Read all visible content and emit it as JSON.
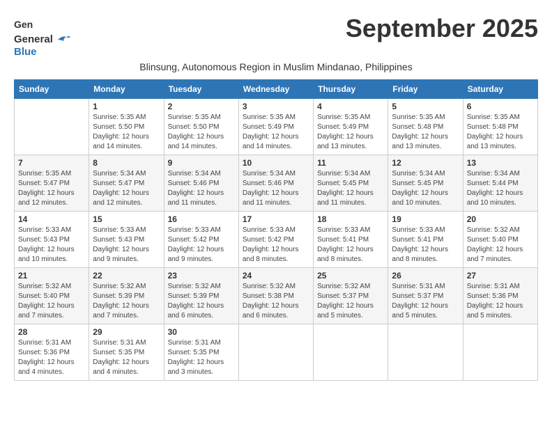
{
  "header": {
    "logo_general": "General",
    "logo_blue": "Blue",
    "month_title": "September 2025",
    "subtitle": "Blinsung, Autonomous Region in Muslim Mindanao, Philippines"
  },
  "days_of_week": [
    "Sunday",
    "Monday",
    "Tuesday",
    "Wednesday",
    "Thursday",
    "Friday",
    "Saturday"
  ],
  "weeks": [
    [
      {
        "day": "",
        "info": ""
      },
      {
        "day": "1",
        "info": "Sunrise: 5:35 AM\nSunset: 5:50 PM\nDaylight: 12 hours\nand 14 minutes."
      },
      {
        "day": "2",
        "info": "Sunrise: 5:35 AM\nSunset: 5:50 PM\nDaylight: 12 hours\nand 14 minutes."
      },
      {
        "day": "3",
        "info": "Sunrise: 5:35 AM\nSunset: 5:49 PM\nDaylight: 12 hours\nand 14 minutes."
      },
      {
        "day": "4",
        "info": "Sunrise: 5:35 AM\nSunset: 5:49 PM\nDaylight: 12 hours\nand 13 minutes."
      },
      {
        "day": "5",
        "info": "Sunrise: 5:35 AM\nSunset: 5:48 PM\nDaylight: 12 hours\nand 13 minutes."
      },
      {
        "day": "6",
        "info": "Sunrise: 5:35 AM\nSunset: 5:48 PM\nDaylight: 12 hours\nand 13 minutes."
      }
    ],
    [
      {
        "day": "7",
        "info": "Sunrise: 5:35 AM\nSunset: 5:47 PM\nDaylight: 12 hours\nand 12 minutes."
      },
      {
        "day": "8",
        "info": "Sunrise: 5:34 AM\nSunset: 5:47 PM\nDaylight: 12 hours\nand 12 minutes."
      },
      {
        "day": "9",
        "info": "Sunrise: 5:34 AM\nSunset: 5:46 PM\nDaylight: 12 hours\nand 11 minutes."
      },
      {
        "day": "10",
        "info": "Sunrise: 5:34 AM\nSunset: 5:46 PM\nDaylight: 12 hours\nand 11 minutes."
      },
      {
        "day": "11",
        "info": "Sunrise: 5:34 AM\nSunset: 5:45 PM\nDaylight: 12 hours\nand 11 minutes."
      },
      {
        "day": "12",
        "info": "Sunrise: 5:34 AM\nSunset: 5:45 PM\nDaylight: 12 hours\nand 10 minutes."
      },
      {
        "day": "13",
        "info": "Sunrise: 5:34 AM\nSunset: 5:44 PM\nDaylight: 12 hours\nand 10 minutes."
      }
    ],
    [
      {
        "day": "14",
        "info": "Sunrise: 5:33 AM\nSunset: 5:43 PM\nDaylight: 12 hours\nand 10 minutes."
      },
      {
        "day": "15",
        "info": "Sunrise: 5:33 AM\nSunset: 5:43 PM\nDaylight: 12 hours\nand 9 minutes."
      },
      {
        "day": "16",
        "info": "Sunrise: 5:33 AM\nSunset: 5:42 PM\nDaylight: 12 hours\nand 9 minutes."
      },
      {
        "day": "17",
        "info": "Sunrise: 5:33 AM\nSunset: 5:42 PM\nDaylight: 12 hours\nand 8 minutes."
      },
      {
        "day": "18",
        "info": "Sunrise: 5:33 AM\nSunset: 5:41 PM\nDaylight: 12 hours\nand 8 minutes."
      },
      {
        "day": "19",
        "info": "Sunrise: 5:33 AM\nSunset: 5:41 PM\nDaylight: 12 hours\nand 8 minutes."
      },
      {
        "day": "20",
        "info": "Sunrise: 5:32 AM\nSunset: 5:40 PM\nDaylight: 12 hours\nand 7 minutes."
      }
    ],
    [
      {
        "day": "21",
        "info": "Sunrise: 5:32 AM\nSunset: 5:40 PM\nDaylight: 12 hours\nand 7 minutes."
      },
      {
        "day": "22",
        "info": "Sunrise: 5:32 AM\nSunset: 5:39 PM\nDaylight: 12 hours\nand 7 minutes."
      },
      {
        "day": "23",
        "info": "Sunrise: 5:32 AM\nSunset: 5:39 PM\nDaylight: 12 hours\nand 6 minutes."
      },
      {
        "day": "24",
        "info": "Sunrise: 5:32 AM\nSunset: 5:38 PM\nDaylight: 12 hours\nand 6 minutes."
      },
      {
        "day": "25",
        "info": "Sunrise: 5:32 AM\nSunset: 5:37 PM\nDaylight: 12 hours\nand 5 minutes."
      },
      {
        "day": "26",
        "info": "Sunrise: 5:31 AM\nSunset: 5:37 PM\nDaylight: 12 hours\nand 5 minutes."
      },
      {
        "day": "27",
        "info": "Sunrise: 5:31 AM\nSunset: 5:36 PM\nDaylight: 12 hours\nand 5 minutes."
      }
    ],
    [
      {
        "day": "28",
        "info": "Sunrise: 5:31 AM\nSunset: 5:36 PM\nDaylight: 12 hours\nand 4 minutes."
      },
      {
        "day": "29",
        "info": "Sunrise: 5:31 AM\nSunset: 5:35 PM\nDaylight: 12 hours\nand 4 minutes."
      },
      {
        "day": "30",
        "info": "Sunrise: 5:31 AM\nSunset: 5:35 PM\nDaylight: 12 hours\nand 3 minutes."
      },
      {
        "day": "",
        "info": ""
      },
      {
        "day": "",
        "info": ""
      },
      {
        "day": "",
        "info": ""
      },
      {
        "day": "",
        "info": ""
      }
    ]
  ]
}
